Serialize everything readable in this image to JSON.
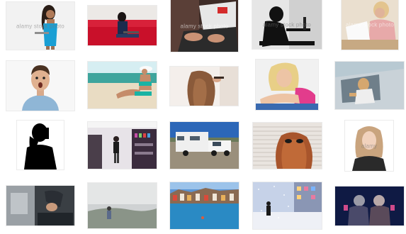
{
  "tiles": [
    {
      "id": "t1",
      "watermark": "alamy stock photo"
    },
    {
      "id": "t2",
      "watermark": ""
    },
    {
      "id": "t3",
      "watermark": "alamy stock photo"
    },
    {
      "id": "t4",
      "watermark": "alamy stock photo"
    },
    {
      "id": "t5",
      "watermark": "alamy stock photo"
    },
    {
      "id": "t6",
      "watermark": ""
    },
    {
      "id": "t7",
      "watermark": ""
    },
    {
      "id": "t8",
      "watermark": ""
    },
    {
      "id": "t9",
      "watermark": ""
    },
    {
      "id": "t10",
      "watermark": ""
    },
    {
      "id": "t11",
      "watermark": ""
    },
    {
      "id": "t12",
      "watermark": ""
    },
    {
      "id": "t13",
      "watermark": ""
    },
    {
      "id": "t14",
      "watermark": ""
    },
    {
      "id": "t15",
      "watermark": "alamy"
    },
    {
      "id": "t16",
      "watermark": ""
    },
    {
      "id": "t17",
      "watermark": ""
    },
    {
      "id": "t18",
      "watermark": ""
    },
    {
      "id": "t19",
      "watermark": ""
    },
    {
      "id": "t20",
      "watermark": ""
    }
  ]
}
